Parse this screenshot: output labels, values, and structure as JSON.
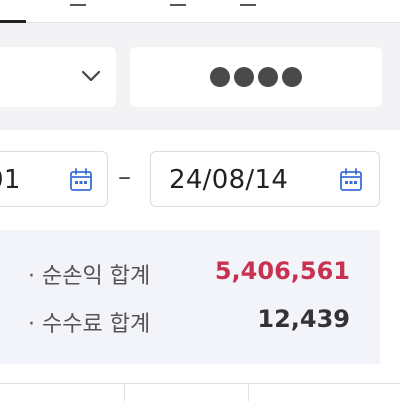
{
  "filters": {
    "select_icon": "chevron-down-icon",
    "masked_value": "●●●●"
  },
  "date_range": {
    "from": "01",
    "separator": "–",
    "to": "24/08/14",
    "icon": "calendar-icon"
  },
  "summary": {
    "rows": [
      {
        "label": "· 순손익 합계",
        "value": "5,406,561",
        "color": "#c8314f"
      },
      {
        "label": "· 수수료 합계",
        "value": "12,439",
        "color": "#333333"
      }
    ]
  }
}
